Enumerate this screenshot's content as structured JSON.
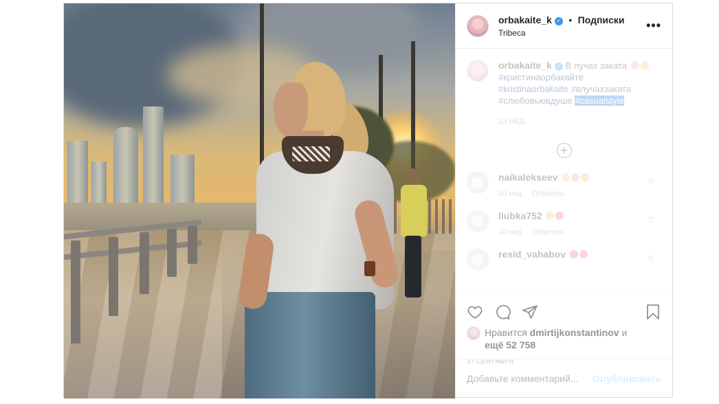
{
  "post": {
    "username": "orbakaite_k",
    "separator": "•",
    "follow_label": "Подписки",
    "location": "Tribeca",
    "more_label": "•••"
  },
  "caption": {
    "username": "orbakaite_k",
    "text": "В лучах заката",
    "hashtags": [
      "#кристинаорбакайте",
      "#kristinaorbakaite",
      "#влучахзаката",
      "#слюбовьювдуше"
    ],
    "selected_hashtag": "#casualstyle",
    "time": "13 нед."
  },
  "comments": [
    {
      "username": "naikalekseev",
      "time": "10 нед.",
      "reply": "Ответить"
    },
    {
      "username": "liubka752",
      "time": "10 нед.",
      "reply": "Ответить"
    },
    {
      "username": "resid_vahabov",
      "time": "",
      "reply": ""
    }
  ],
  "likes": {
    "prefix": "Нравится",
    "liker": "dmirtijkonstantinov",
    "suffix": "и",
    "more": "ещё 52 758"
  },
  "date": "17 сентября",
  "add_comment": {
    "placeholder": "Добавьте комментарий...",
    "publish": "Опубликовать"
  },
  "icons": [
    "heart-icon",
    "comment-icon",
    "share-icon",
    "bookmark-icon",
    "more-icon",
    "verified-badge-icon",
    "plus-circle-icon"
  ],
  "colors": {
    "verified": "#3897f0",
    "hashtag": "#00376b",
    "selection": "#1f6fd6",
    "publish": "#b2dffc"
  }
}
